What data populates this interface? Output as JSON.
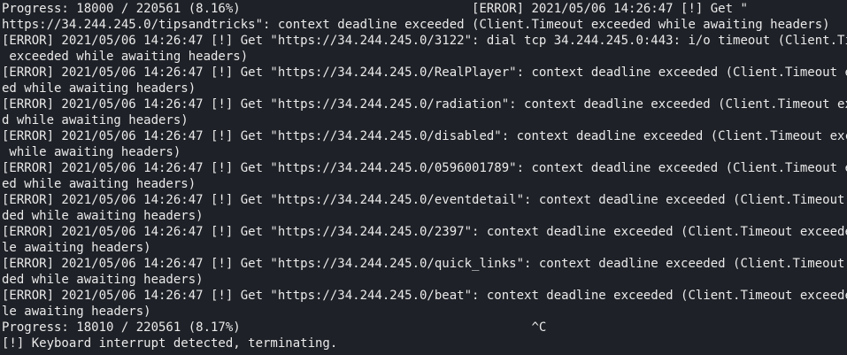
{
  "terminal": {
    "background": "#1e2127",
    "foreground": "#eaeaea",
    "lines": [
      "Progress: 18000 / 220561 (8.16%)                               [ERROR] 2021/05/06 14:26:47 [!] Get \"",
      "https://34.244.245.0/tipsandtricks\": context deadline exceeded (Client.Timeout exceeded while awaiting headers)",
      "[ERROR] 2021/05/06 14:26:47 [!] Get \"https://34.244.245.0/3122\": dial tcp 34.244.245.0:443: i/o timeout (Client.Timeout",
      " exceeded while awaiting headers)",
      "[ERROR] 2021/05/06 14:26:47 [!] Get \"https://34.244.245.0/RealPlayer\": context deadline exceeded (Client.Timeout exceed",
      "ed while awaiting headers)",
      "[ERROR] 2021/05/06 14:26:47 [!] Get \"https://34.244.245.0/radiation\": context deadline exceeded (Client.Timeout exceede",
      "d while awaiting headers)",
      "[ERROR] 2021/05/06 14:26:47 [!] Get \"https://34.244.245.0/disabled\": context deadline exceeded (Client.Timeout exceeded",
      " while awaiting headers)",
      "[ERROR] 2021/05/06 14:26:47 [!] Get \"https://34.244.245.0/0596001789\": context deadline exceeded (Client.Timeout exceed",
      "ed while awaiting headers)",
      "[ERROR] 2021/05/06 14:26:47 [!] Get \"https://34.244.245.0/eventdetail\": context deadline exceeded (Client.Timeout excee",
      "ded while awaiting headers)",
      "[ERROR] 2021/05/06 14:26:47 [!] Get \"https://34.244.245.0/2397\": context deadline exceeded (Client.Timeout exceeded whi",
      "le awaiting headers)",
      "[ERROR] 2021/05/06 14:26:47 [!] Get \"https://34.244.245.0/quick_links\": context deadline exceeded (Client.Timeout excee",
      "ded while awaiting headers)",
      "[ERROR] 2021/05/06 14:26:47 [!] Get \"https://34.244.245.0/beat\": context deadline exceeded (Client.Timeout exceeded whi",
      "le awaiting headers)",
      "Progress: 18010 / 220561 (8.17%)                                       ^C",
      "[!] Keyboard interrupt detected, terminating."
    ]
  }
}
